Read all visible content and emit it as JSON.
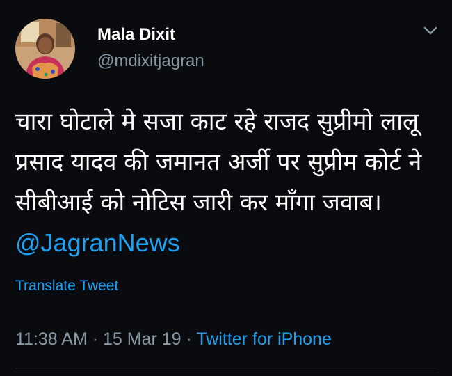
{
  "user": {
    "display_name": "Mala Dixit",
    "handle": "@mdixitjagran"
  },
  "tweet": {
    "text": "चारा घोटाले मे सजा काट रहे राजद सुप्रीमो लालू प्रसाद यादव की जमानत अर्जी पर सुप्रीम कोर्ट ने सीबीआई को नोटिस जारी कर माँगा जवाब। ",
    "mention": "@JagranNews",
    "translate_label": "Translate Tweet"
  },
  "meta": {
    "time": "11:38 AM",
    "sep1": " · ",
    "date": "15 Mar 19",
    "sep2": " · ",
    "source": "Twitter for iPhone"
  },
  "icons": {
    "menu": "chevron-down-icon"
  },
  "colors": {
    "background": "#0a0b0f",
    "text": "#ffffff",
    "secondary": "#8899a6",
    "accent": "#1da1f2"
  }
}
